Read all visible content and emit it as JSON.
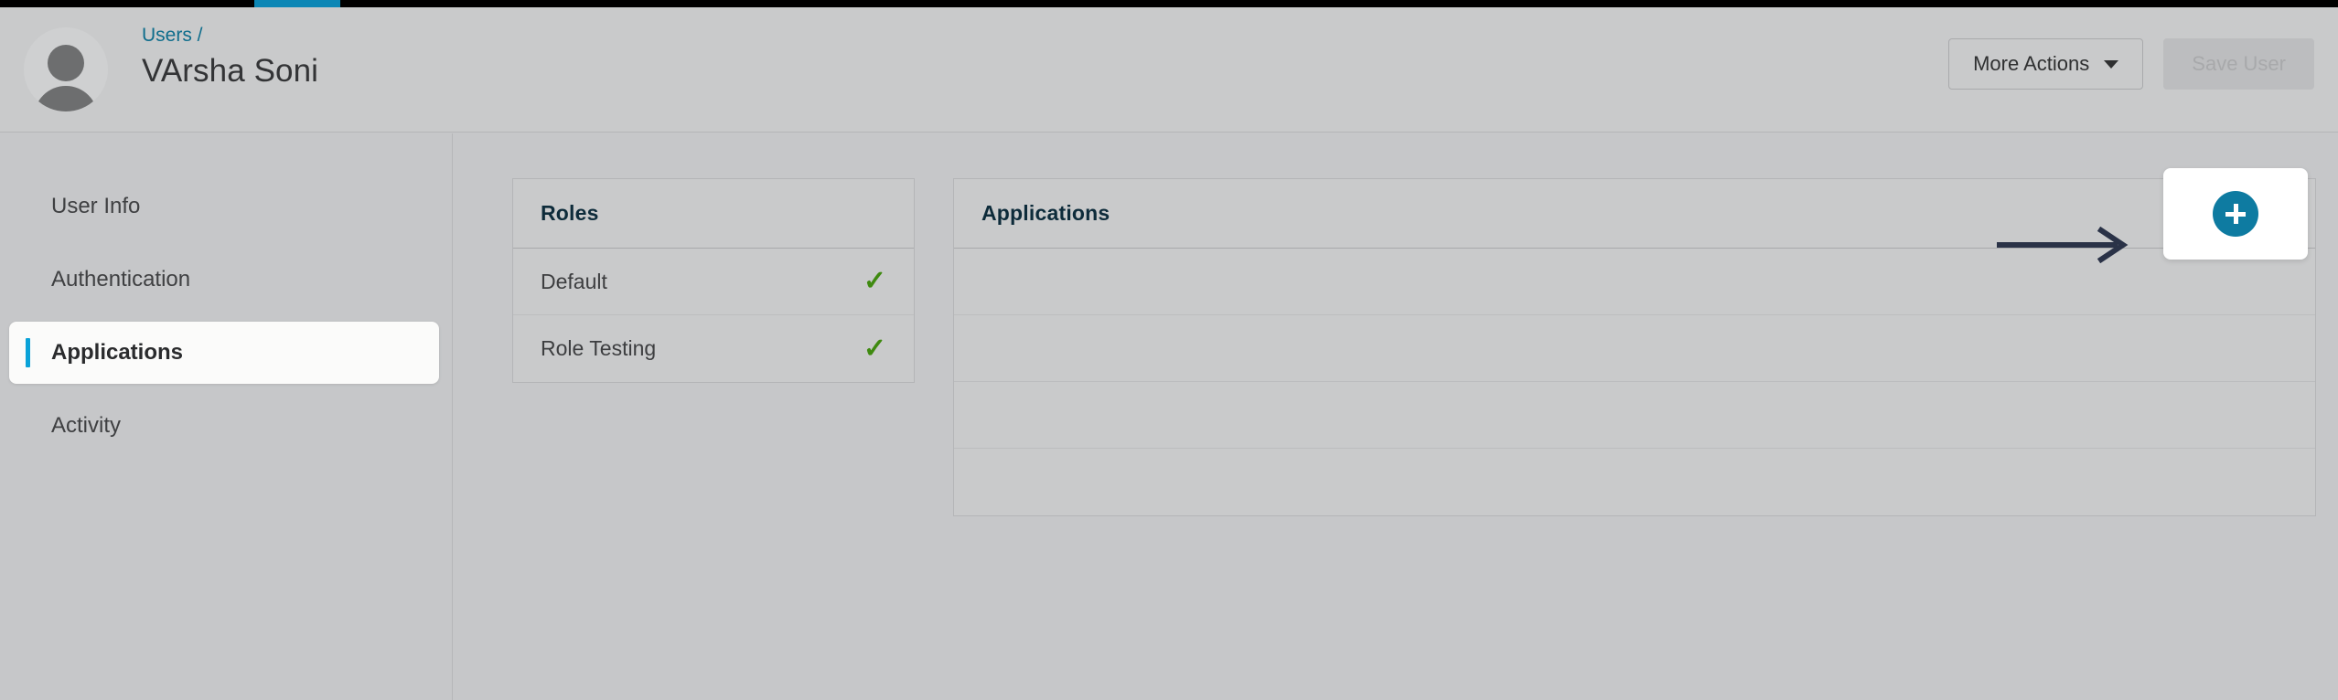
{
  "topbar": {
    "progress_accent_color": "#0c86b5",
    "bar_color": "#000000"
  },
  "header": {
    "avatar_icon": "user-avatar-placeholder-icon",
    "breadcrumb": "Users /",
    "title": "VArsha Soni",
    "actions": {
      "more_actions_label": "More Actions",
      "more_actions_caret_icon": "chevron-down-icon",
      "save_user_label": "Save User",
      "save_user_disabled": true
    }
  },
  "sidebar": {
    "items": [
      {
        "label": "User Info",
        "active": false
      },
      {
        "label": "Authentication",
        "active": false
      },
      {
        "label": "Applications",
        "active": true
      },
      {
        "label": "Activity",
        "active": false
      }
    ],
    "active_indicator_color": "#0aa2d8"
  },
  "main": {
    "roles_card": {
      "title": "Roles",
      "rows": [
        {
          "name": "Default",
          "checked_icon": "check-icon"
        },
        {
          "name": "Role Testing",
          "checked_icon": "check-icon"
        }
      ],
      "check_color": "#3f8a10"
    },
    "applications_card": {
      "title": "Applications",
      "empty_row_count": 4,
      "add_button": {
        "icon": "plus-icon",
        "color": "#0e7ba1"
      },
      "annotation": {
        "type": "arrow-right",
        "color": "#2a3247",
        "points_to": "add-application-button"
      }
    }
  }
}
